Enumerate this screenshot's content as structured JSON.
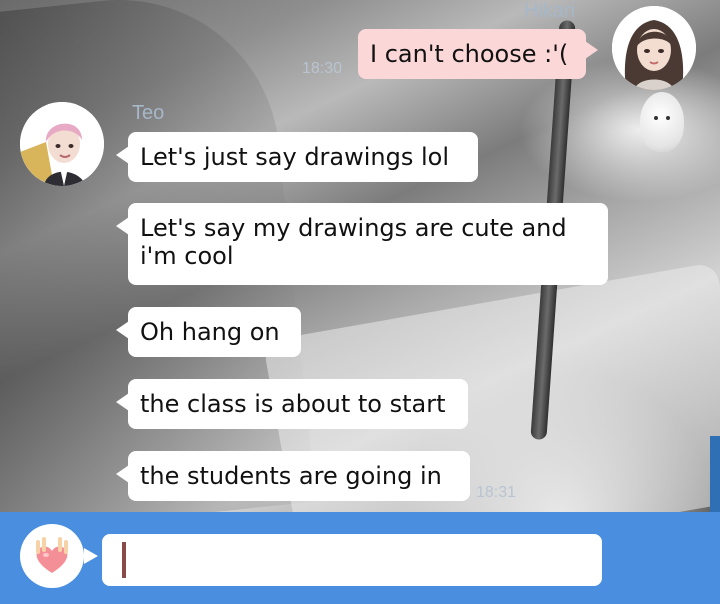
{
  "messages": {
    "hikari": {
      "name": "Hikari",
      "time": "18:30",
      "text": "I can't choose :'("
    },
    "teo": {
      "name": "Teo",
      "time": "18:31",
      "texts": [
        "Let's just say drawings lol",
        "Let's say my drawings are cute and i'm cool",
        "Oh hang on",
        "the class is about to start",
        "the students are going in"
      ]
    }
  },
  "input": {
    "value": "",
    "emote_icon": "heart-hand-icon"
  },
  "colors": {
    "input_bar": "#4a8ee0",
    "outgoing_bubble": "#fbd7d7",
    "incoming_bubble": "#ffffff",
    "name_text": "#a6b7c9"
  }
}
